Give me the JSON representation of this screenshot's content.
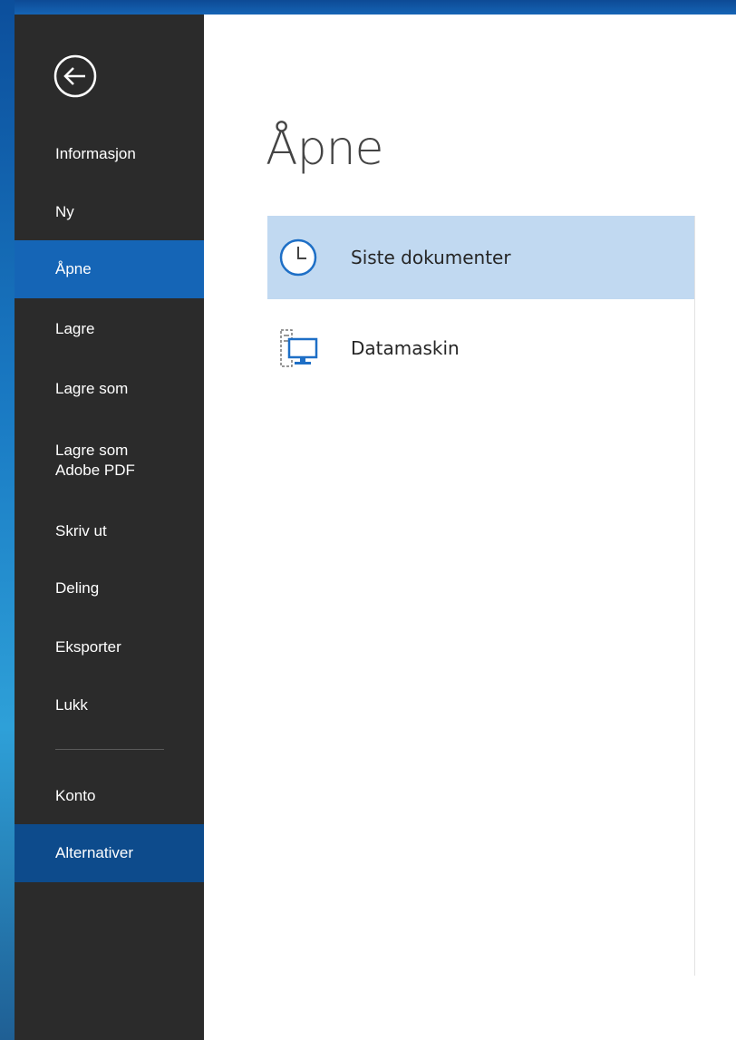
{
  "backstage": {
    "back_label": "",
    "nav_items": [
      {
        "label": "Informasjon"
      },
      {
        "label": "Ny"
      },
      {
        "label": "Åpne"
      },
      {
        "label": "Lagre"
      },
      {
        "label": "Lagre som"
      },
      {
        "label": "Lagre som\nAdobe PDF"
      },
      {
        "label": "Skriv ut"
      },
      {
        "label": "Deling"
      },
      {
        "label": "Eksporter"
      },
      {
        "label": "Lukk"
      },
      {
        "label": "Konto"
      },
      {
        "label": "Alternativer"
      }
    ],
    "selected_item": "Åpne",
    "hovered_item": "Alternativer"
  },
  "main": {
    "title": "Åpne",
    "locations": [
      {
        "label": "Siste dokumenter",
        "icon": "clock-icon",
        "selected": true
      },
      {
        "label": "Datamaskin",
        "icon": "computer-icon",
        "selected": false
      }
    ]
  },
  "colors": {
    "nav_bg": "#2b2b2b",
    "nav_selected": "#1565b6",
    "nav_hover": "#0d4b8c",
    "location_selected": "#c1d9f1",
    "icon_blue": "#1e6fc6"
  }
}
